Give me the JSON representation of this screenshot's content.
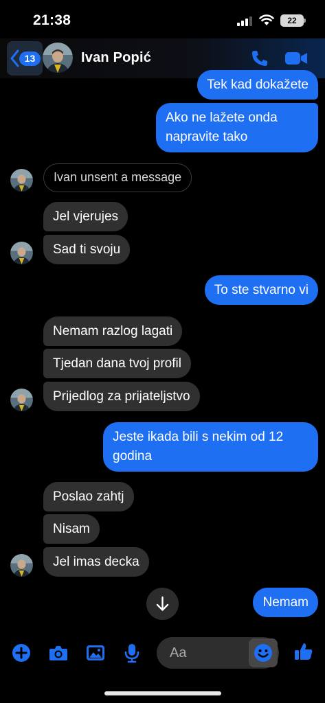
{
  "status_bar": {
    "time": "21:38",
    "battery": "22"
  },
  "header": {
    "back_count": "13",
    "contact_name": "Ivan Popić",
    "accent": "#1f6ff2"
  },
  "conversation": {
    "unsent_notice": "Ivan unsent a message",
    "outgoing_1": "Tek kad dokažete",
    "outgoing_2": "Ako ne lažete onda napravite tako",
    "incoming_1": "Jel vjerujes",
    "incoming_2": "Sad ti svoju",
    "outgoing_3": "To ste stvarno vi",
    "incoming_3": "Nemam razlog lagati",
    "incoming_4": "Tjedan dana tvoj profil",
    "incoming_5": "Prijedlog za prijateljstvo",
    "outgoing_4": "Jeste ikada bili s nekim od 12 godina",
    "incoming_6": "Poslao zahtj",
    "incoming_7": "Nisam",
    "incoming_8": "Jel imas decka",
    "outgoing_5": "Nemam",
    "colors": {
      "incoming_bubble": "#303030",
      "outgoing_bubble": "#1f6ff2"
    }
  },
  "composer": {
    "placeholder": "Aa",
    "icons": [
      "plus-icon",
      "camera-icon",
      "image-icon",
      "microphone-icon",
      "emoji-icon",
      "thumbs-up-icon"
    ]
  }
}
